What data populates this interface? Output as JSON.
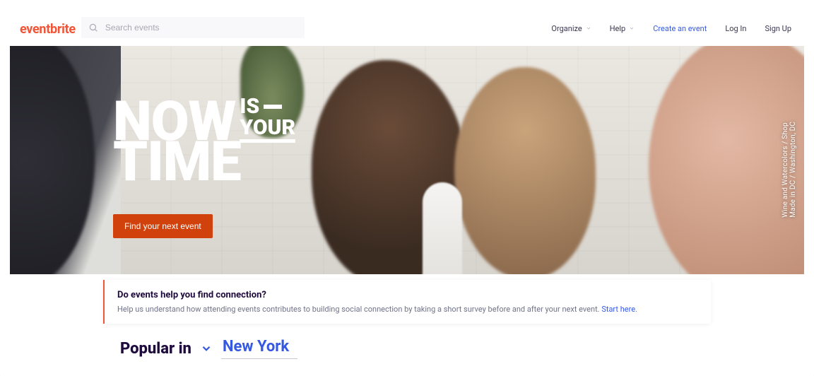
{
  "brand": "eventbrite",
  "colors": {
    "accent": "#f05537",
    "link": "#3659e3",
    "cta": "#d1410c"
  },
  "search": {
    "placeholder": "Search events",
    "value": ""
  },
  "nav": {
    "organize": "Organize",
    "help": "Help",
    "create": "Create an event",
    "login": "Log In",
    "signup": "Sign Up"
  },
  "hero": {
    "line_now": "NOW",
    "line_is": "IS",
    "line_your": "YOUR",
    "line_time": "TIME",
    "cta_label": "Find your next event",
    "credit": "Wine and Watercolors / Shop Made in DC / Washington, DC"
  },
  "survey": {
    "title": "Do events help you find connection?",
    "desc": "Help us understand how attending events contributes to building social connection by taking a short survey before and after your next event. ",
    "link_label": "Start here",
    "period": "."
  },
  "popular": {
    "label": "Popular in",
    "city": "New York"
  }
}
